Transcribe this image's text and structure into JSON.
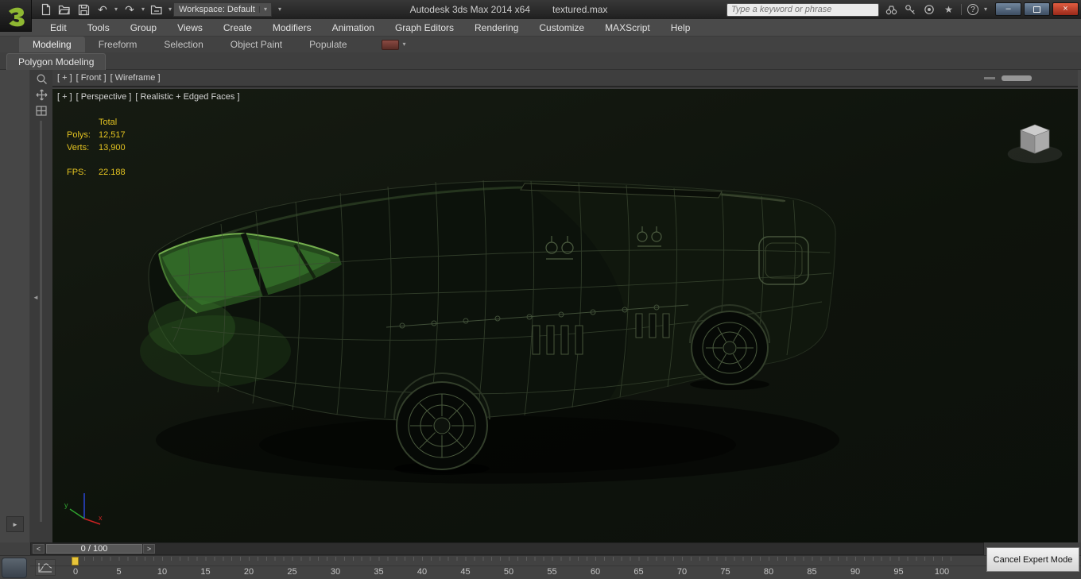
{
  "titlebar": {
    "workspace_label": "Workspace: Default",
    "app_title": "Autodesk 3ds Max 2014 x64",
    "file_name": "textured.max",
    "search_placeholder": "Type a keyword or phrase"
  },
  "menubar": {
    "items": [
      "Edit",
      "Tools",
      "Group",
      "Views",
      "Create",
      "Modifiers",
      "Animation",
      "Graph Editors",
      "Rendering",
      "Customize",
      "MAXScript",
      "Help"
    ]
  },
  "ribbon": {
    "tabs": [
      {
        "label": "Modeling",
        "active": true
      },
      {
        "label": "Freeform",
        "active": false
      },
      {
        "label": "Selection",
        "active": false
      },
      {
        "label": "Object Paint",
        "active": false
      },
      {
        "label": "Populate",
        "active": false
      }
    ],
    "subtab": "Polygon Modeling"
  },
  "viewport_front": {
    "menu_maximize": "[ + ]",
    "menu_view": "[ Front ]",
    "menu_shading": "[ Wireframe ]"
  },
  "viewport_perspective": {
    "menu_maximize": "[ + ]",
    "menu_view": "[ Perspective ]",
    "menu_shading": "[ Realistic + Edged Faces ]"
  },
  "statistics": {
    "total_label": "Total",
    "polys_label": "Polys:",
    "polys_value": "12,517",
    "verts_label": "Verts:",
    "verts_value": "13,900",
    "fps_label": "FPS:",
    "fps_value": "22.188"
  },
  "axis_gizmo": {
    "x_label": "x",
    "y_label": "y"
  },
  "timeline": {
    "prev_label": "<",
    "next_label": ">",
    "frame_display": "0 / 100"
  },
  "trackbar": {
    "ticks": [
      "0",
      "5",
      "10",
      "15",
      "20",
      "25",
      "30",
      "35",
      "40",
      "45",
      "50",
      "55",
      "60",
      "65",
      "70",
      "75",
      "80",
      "85",
      "90",
      "95",
      "100"
    ]
  },
  "expert_mode": {
    "cancel_label": "Cancel Expert Mode"
  },
  "glyphs": {
    "undo": "↶",
    "redo": "↷",
    "caret_down": "▾",
    "star": "★",
    "help": "?",
    "minimize": "–",
    "close": "×",
    "expand_right": "►",
    "collapse_left": "◄"
  },
  "colors": {
    "stats_text": "#e3c321",
    "close_button": "#c0392b",
    "time_marker": "#e8c53a",
    "viewport_bg": "#0e130c"
  }
}
